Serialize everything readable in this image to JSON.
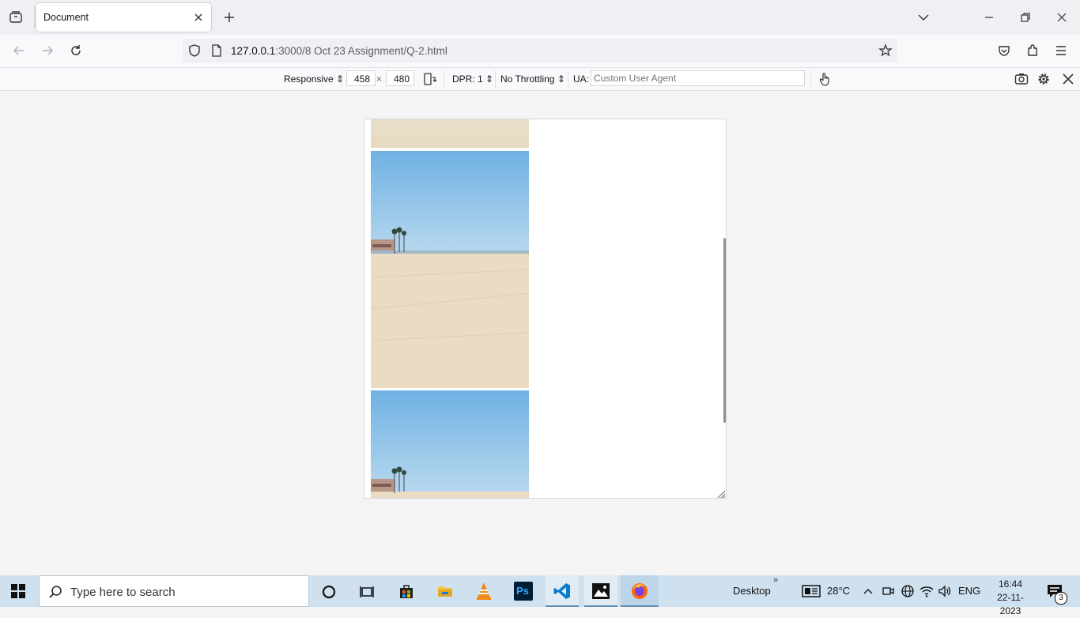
{
  "tab": {
    "title": "Document"
  },
  "urlbar": {
    "host": "127.0.0.1",
    "path": ":3000/8 Oct 23 Assignment/Q-2.html"
  },
  "rdm": {
    "device": "Responsive",
    "width": "458",
    "times": "×",
    "height": "480",
    "dpr": "DPR: 1",
    "throttling": "No Throttling",
    "ua_label": "UA:",
    "ua_placeholder": "Custom User Agent"
  },
  "taskbar": {
    "search_placeholder": "Type here to search",
    "desktop_label": "Desktop",
    "temperature": "28°C",
    "language": "ENG",
    "time": "16:44",
    "date": "22-11-2023",
    "notification_count": "3"
  },
  "icons": [
    "tab-list-icon",
    "close-icon",
    "new-tab-icon",
    "tabs-dropdown-icon",
    "minimize-icon",
    "restore-icon",
    "back-icon",
    "forward-icon",
    "reload-icon",
    "shield-icon",
    "page-icon",
    "star-icon",
    "pocket-icon",
    "extensions-icon",
    "menu-icon",
    "rotate-icon",
    "touch-icon",
    "screenshot-icon",
    "settings-icon",
    "windows-start-icon",
    "search-icon",
    "cortana-icon",
    "task-view-icon",
    "store-icon",
    "file-explorer-icon",
    "vlc-icon",
    "photoshop-icon",
    "vscode-icon",
    "photos-icon",
    "firefox-icon",
    "chevron-up-icon",
    "wifi-icon",
    "volume-icon",
    "notification-icon"
  ],
  "colors": {
    "accent_firefox": "#ff6611",
    "taskbar": "#cfe1ef",
    "sky": "#8ec3e8",
    "sand": "#e8dcc3"
  }
}
